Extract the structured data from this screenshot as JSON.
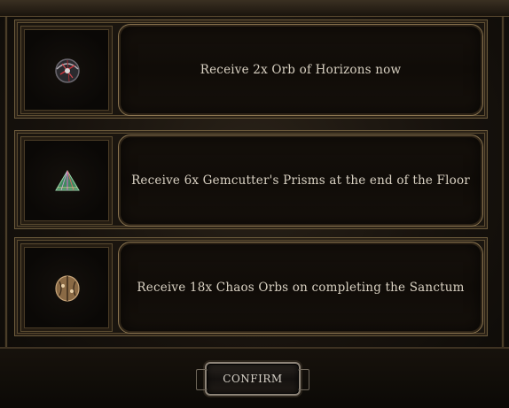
{
  "options": [
    {
      "icon": "orb-of-horizons-icon",
      "text": "Receive 2x Orb of Horizons now"
    },
    {
      "icon": "gemcutters-prism-icon",
      "text": "Receive 6x Gemcutter's Prisms at the end of the Floor"
    },
    {
      "icon": "chaos-orb-icon",
      "text": "Receive 18x Chaos Orbs on completing the Sanctum"
    }
  ],
  "confirm_label": "CONFIRM",
  "colors": {
    "frame_gold": "#8a7450",
    "text": "#d9d1c2",
    "panel_dark": "#100c08"
  }
}
